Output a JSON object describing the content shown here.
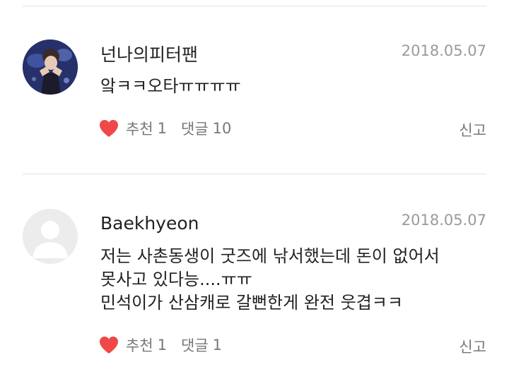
{
  "comments": [
    {
      "author": "넌나의피터팬",
      "date": "2018.05.07",
      "avatar": "user-photo",
      "lines": [
        "앜ㅋㅋ오타ㅠㅠㅠㅠ"
      ],
      "like_label": "추천",
      "like_count": "1",
      "reply_label": "댓글",
      "reply_count": "10",
      "report_label": "신고"
    },
    {
      "author": "Baekhyeon",
      "date": "2018.05.07",
      "avatar": "default-user-icon",
      "lines": [
        "저는 사촌동생이 굿즈에 낚서했는데 돈이 없어서",
        "못사고 있다능....ㅠㅠ",
        "민석이가 산삼캐로 갈뻔한게 완전 웃겹ㅋㅋ"
      ],
      "like_label": "추천",
      "like_count": "1",
      "reply_label": "댓글",
      "reply_count": "1",
      "report_label": "신고"
    }
  ],
  "colors": {
    "heart": "#f04848",
    "divider": "#e4e4e4",
    "meta_text": "#9a9a9a",
    "action_text": "#777777"
  }
}
